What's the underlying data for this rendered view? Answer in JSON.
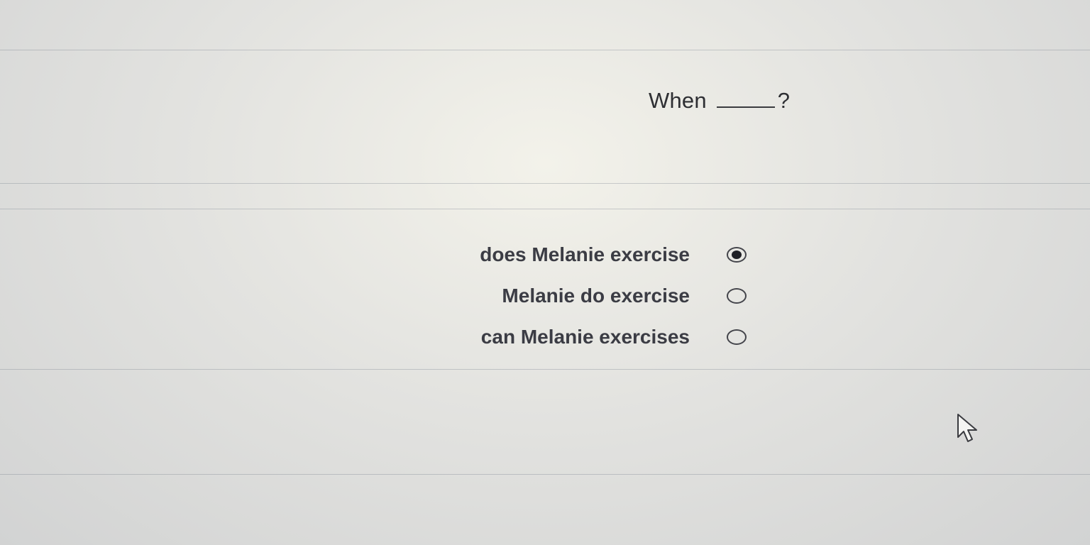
{
  "question": {
    "prefix": "When",
    "suffix": "?"
  },
  "options": [
    {
      "label": "does Melanie exercise",
      "selected": true
    },
    {
      "label": "Melanie do exercise",
      "selected": false
    },
    {
      "label": "can Melanie exercises",
      "selected": false
    }
  ],
  "colors": {
    "text": "#3b3c44",
    "radio": "#44454b",
    "background": "#dcdcda"
  },
  "icons": {
    "cursor": "mouse-pointer-icon"
  }
}
